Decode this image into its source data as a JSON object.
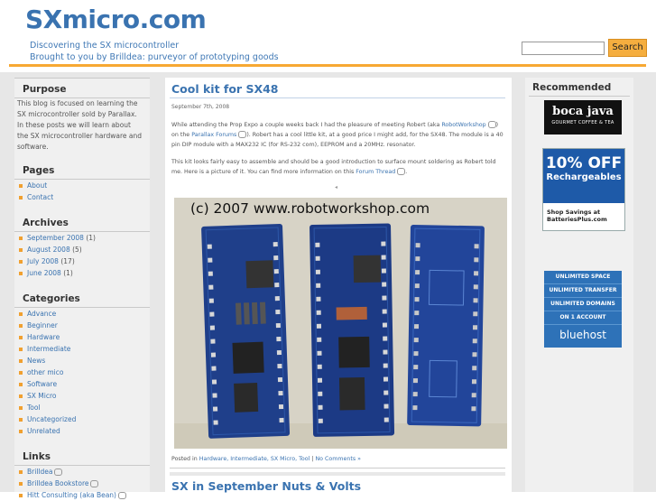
{
  "site": {
    "title": "SXmicro.com",
    "tagline1": "Discovering the SX microcontroller",
    "tagline2": "Brought to you by Brilldea: purveyor of prototyping goods"
  },
  "search": {
    "button_label": "Search",
    "value": ""
  },
  "sidebar": {
    "purpose_heading": "Purpose",
    "purpose_text": "This blog is focused on learning the SX microcontroller sold by Parallax. In these posts we will learn about the SX microcontroller hardware and software.",
    "pages_heading": "Pages",
    "pages": [
      {
        "label": "About"
      },
      {
        "label": "Contact"
      }
    ],
    "archives_heading": "Archives",
    "archives": [
      {
        "label": "September 2008",
        "count": "(1)"
      },
      {
        "label": "August 2008",
        "count": "(5)"
      },
      {
        "label": "July 2008",
        "count": "(17)"
      },
      {
        "label": "June 2008",
        "count": "(1)"
      }
    ],
    "categories_heading": "Categories",
    "categories": [
      {
        "label": "Advance"
      },
      {
        "label": "Beginner"
      },
      {
        "label": "Hardware"
      },
      {
        "label": "Intermediate"
      },
      {
        "label": "News"
      },
      {
        "label": "other mico"
      },
      {
        "label": "Software"
      },
      {
        "label": "SX Micro"
      },
      {
        "label": "Tool"
      },
      {
        "label": "Uncategorized"
      },
      {
        "label": "Unrelated"
      }
    ],
    "links_heading": "Links",
    "links": [
      {
        "label": "Brilldea"
      },
      {
        "label": "Brilldea Bookstore"
      },
      {
        "label": "Hitt Consulting (aka Bean)"
      }
    ]
  },
  "post": {
    "title": "Cool kit for SX48",
    "date": "September 7th, 2008",
    "para1_a": "While attending the Prop Expo a couple weeks back I had the pleasure of meeting Robert (aka ",
    "para1_link1": "RobotWorkshop",
    "para1_b": ") on the ",
    "para1_link2": "Parallax Forums",
    "para1_c": "). Robert has a cool little kit, at a good price I might add, for the SX48. The module is a 40 pin DIP module with a MAX232 IC (for RS-232 com), EEPROM and a 20MHz. resonator.",
    "para2_a": "This kit looks fairly easy to assemble and should be a good introduction to surface mount soldering as Robert told me. Here is a picture of it. You can find more information on this ",
    "para2_link": "Forum Thread",
    "para2_b": ".",
    "photo_caption": "(c) 2007 www.robotworkshop.com",
    "meta_prefix": "Posted in ",
    "meta_categories": "Hardware, Intermediate, SX Micro, Tool",
    "meta_sep": " | ",
    "meta_comments": "No Comments »",
    "next_title": "SX in September Nuts & Volts"
  },
  "rightbar": {
    "heading": "Recommended",
    "ad1": {
      "line1": "boca java",
      "line2": "GOURMET COFFEE & TEA"
    },
    "ad2": {
      "big": "10% OFF",
      "small": "Rechargeables",
      "bottom1": "Shop Savings at",
      "bottom2": "BatteriesPlus.com"
    },
    "ad3": {
      "l1": "UNLIMITED SPACE",
      "l2": "UNLIMITED TRANSFER",
      "l3": "UNLIMITED DOMAINS",
      "l4": "ON 1 ACCOUNT",
      "logo": "bluehost"
    }
  },
  "colors": {
    "accent": "#f7a833",
    "link": "#3a73b0",
    "board": "#1f3f8a"
  }
}
